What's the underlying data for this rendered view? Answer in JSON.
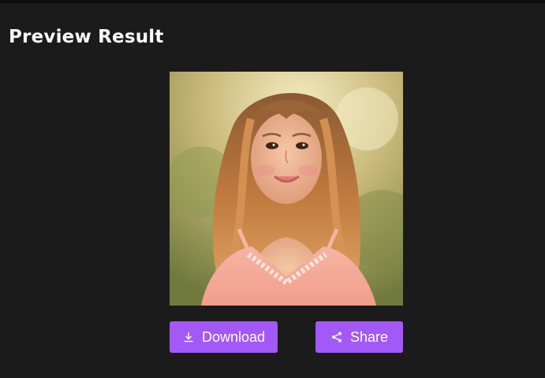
{
  "header": {
    "title": "Preview Result"
  },
  "preview": {
    "image_description_icon": "portrait-image"
  },
  "actions": {
    "download_label": "Download",
    "download_icon": "download-icon",
    "share_label": "Share",
    "share_icon": "share-icon"
  },
  "colors": {
    "background": "#1b1b1b",
    "accent": "#a259f7",
    "text": "#ffffff"
  }
}
